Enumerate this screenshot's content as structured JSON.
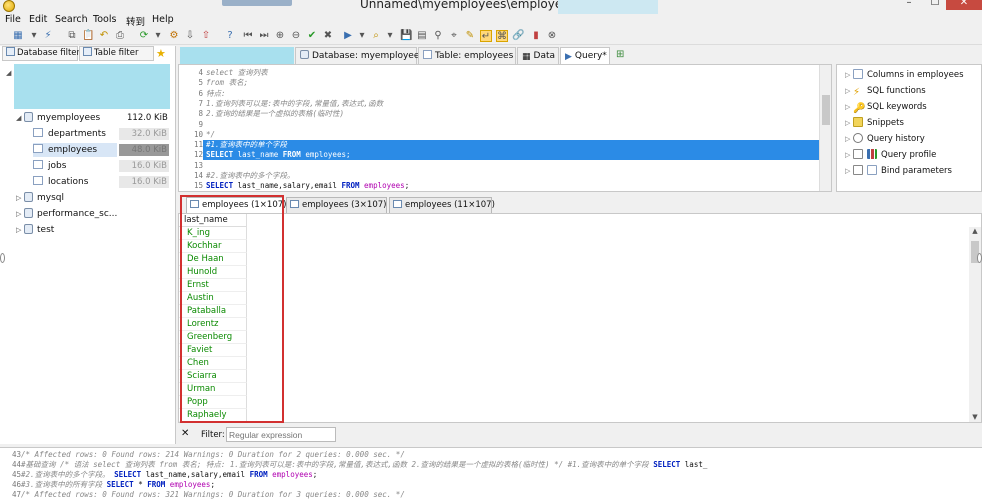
{
  "window": {
    "title": "Unnamed\\myemployees\\employees\\ - Heid",
    "buttons": {
      "minimize": "–",
      "maximize": "☐",
      "close": "✕"
    }
  },
  "menu": [
    "File",
    "Edit",
    "Search",
    "Tools",
    "转到",
    "Help"
  ],
  "left": {
    "database_filter_tab": "Database filter",
    "table_filter_tab": "Table filter",
    "tree": [
      {
        "label": "myemployees",
        "size": "112.0 KiB"
      },
      {
        "label": "departments",
        "size": "32.0 KiB"
      },
      {
        "label": "employees",
        "size": "48.0 KiB"
      },
      {
        "label": "jobs",
        "size": "16.0 KiB"
      },
      {
        "label": "locations",
        "size": "16.0 KiB"
      },
      {
        "label": "mysql"
      },
      {
        "label": "performance_sc..."
      },
      {
        "label": "test"
      }
    ]
  },
  "tabs": {
    "database": "Database: myemployees",
    "table": "Table: employees",
    "data": "Data",
    "query": "Query*"
  },
  "editor": {
    "lines": [
      {
        "n": "4",
        "parts": [
          [
            "cm",
            "select 查询列表"
          ]
        ]
      },
      {
        "n": "5",
        "parts": [
          [
            "cm",
            "from 表名;"
          ]
        ]
      },
      {
        "n": "6",
        "parts": [
          [
            "cm",
            "特点:"
          ]
        ]
      },
      {
        "n": "7",
        "parts": [
          [
            "cm",
            "1.查询列表可以是:表中的字段,常量值,表达式,函数"
          ]
        ]
      },
      {
        "n": "8",
        "parts": [
          [
            "cm",
            "2.查询的结果是一个虚拟的表格(临时性)"
          ]
        ]
      },
      {
        "n": "9",
        "parts": []
      },
      {
        "n": "10",
        "parts": [
          [
            "cm",
            "*/"
          ]
        ]
      },
      {
        "n": "11",
        "parts": [
          [
            "cm",
            "#1.查询表中的单个字段"
          ]
        ]
      },
      {
        "n": "12",
        "parts": [
          [
            "kw",
            "SELECT"
          ],
          [
            "",
            " last_name "
          ],
          [
            "kw",
            "FROM"
          ],
          [
            "",
            " employees;"
          ]
        ]
      },
      {
        "n": "13",
        "parts": []
      },
      {
        "n": "14",
        "parts": [
          [
            "cm",
            "#2.查询表中的多个字段。"
          ]
        ]
      },
      {
        "n": "15",
        "parts": [
          [
            "kw",
            "SELECT"
          ],
          [
            "",
            " last_name,salary,email "
          ],
          [
            "kw",
            "FROM"
          ],
          [
            "tbl",
            " employees"
          ],
          [
            "",
            ";"
          ]
        ]
      }
    ]
  },
  "helpers": [
    "Columns in employees",
    "SQL functions",
    "SQL keywords",
    "Snippets",
    "Query history",
    "Query profile",
    "Bind parameters"
  ],
  "results": {
    "tabs": [
      "employees (1×107)",
      "employees (3×107)",
      "employees (11×107)"
    ],
    "column": "last_name",
    "rows": [
      "K_ing",
      "Kochhar",
      "De Haan",
      "Hunold",
      "Ernst",
      "Austin",
      "Pataballa",
      "Lorentz",
      "Greenberg",
      "Faviet",
      "Chen",
      "Sciarra",
      "Urman",
      "Popp",
      "Raphaely"
    ]
  },
  "filter": {
    "close_glyph": "✕",
    "label": "Filter:",
    "placeholder": "Regular expression"
  },
  "log": [
    {
      "n": "43",
      "parts": [
        [
          "cm",
          "/* Affected rows: 0  Found rows: 214  Warnings: 0  Duration for 2 queries: 0.000 sec. */"
        ]
      ]
    },
    {
      "n": "44",
      "parts": [
        [
          "cm",
          "#基础查询  /*  语法  select 查询列表  from 表名;   特点: 1.查询列表可以是:表中的字段,常量值,表达式,函数  2.查询的结果是一个虚拟的表格(临时性)    */  #1.查询表中的单个字段  "
        ],
        [
          "kw",
          "SELECT"
        ],
        [
          "",
          " last_"
        ]
      ]
    },
    {
      "n": "45",
      "parts": [
        [
          "cm",
          "#2.查询表中的多个字段。  "
        ],
        [
          "kw",
          "SELECT"
        ],
        [
          "",
          " last_name,salary,email "
        ],
        [
          "kw",
          "FROM"
        ],
        [
          "tbl",
          " employees"
        ],
        [
          "",
          ";"
        ]
      ]
    },
    {
      "n": "46",
      "parts": [
        [
          "cm",
          "#3.查询表中的所有字段  "
        ],
        [
          "kw",
          "SELECT"
        ],
        [
          "",
          " * "
        ],
        [
          "kw",
          "FROM"
        ],
        [
          "tbl",
          " employees"
        ],
        [
          "",
          ";"
        ]
      ]
    },
    {
      "n": "47",
      "parts": [
        [
          "cm",
          "/* Affected rows: 0  Found rows: 321  Warnings: 0  Duration for 3 queries: 0.000 sec. */"
        ]
      ]
    }
  ],
  "colors": {
    "highlight": "#2b8be6",
    "keyword": "#0020c0",
    "comment": "#888888",
    "table_name": "#b000b0",
    "cell_text": "#0a8a00",
    "annotation_box": "#d23030"
  }
}
